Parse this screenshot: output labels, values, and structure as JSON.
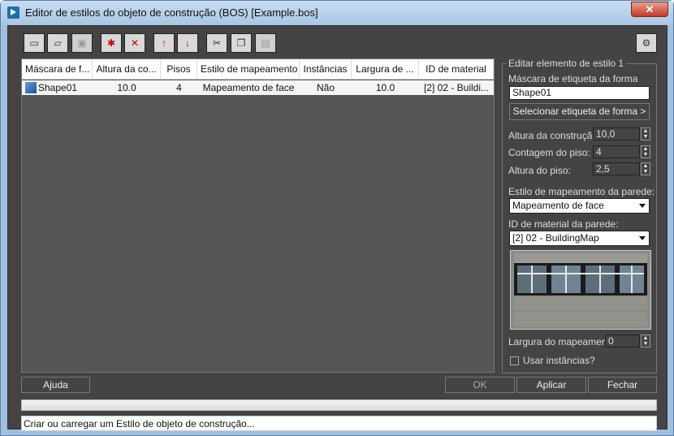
{
  "window": {
    "title": "Editor de estilos do objeto de construção (BOS) [Example.bos]",
    "close_glyph": "✕"
  },
  "toolbar": {
    "buttons": [
      {
        "name": "new-file-icon",
        "glyph": "▭",
        "disabled": false
      },
      {
        "name": "open-folder-icon",
        "glyph": "▱",
        "disabled": false
      },
      {
        "name": "save-icon",
        "glyph": "▣",
        "disabled": true
      },
      {
        "name": "new-style-icon",
        "glyph": "✱",
        "disabled": false
      },
      {
        "name": "delete-style-icon",
        "glyph": "✕",
        "disabled": false
      },
      {
        "name": "move-up-icon",
        "glyph": "↑",
        "disabled": false
      },
      {
        "name": "move-down-icon",
        "glyph": "↓",
        "disabled": false
      },
      {
        "name": "cut-icon",
        "glyph": "✂",
        "disabled": false
      },
      {
        "name": "copy-icon",
        "glyph": "❐",
        "disabled": false
      },
      {
        "name": "paste-icon",
        "glyph": "▤",
        "disabled": true
      }
    ],
    "settings_glyph": "⚙"
  },
  "list": {
    "columns": [
      "Máscara de f...",
      "Altura da co...",
      "Pisos",
      "Estilo de mapeamento",
      "Instâncias",
      "Largura de ...",
      "ID de material"
    ],
    "rows": [
      {
        "cells": [
          "Shape01",
          "10.0",
          "4",
          "Mapeamento de face",
          "Não",
          "10.0",
          "[2] 02 - Buildi..."
        ]
      }
    ]
  },
  "editor": {
    "group_title": "Editar elemento de estilo 1",
    "mask_label": "Máscara de etiqueta da forma",
    "mask_value": "Shape01",
    "select_shape_label": "Selecionar etiqueta de forma >",
    "build_height_label": "Altura da construção:",
    "build_height_value": "10,0",
    "floor_count_label": "Contagem do piso:",
    "floor_count_value": "4",
    "floor_height_label": "Altura do piso:",
    "floor_height_value": "2,5",
    "wall_mapping_label": "Estilo de mapeamento da parede:",
    "wall_mapping_value": "Mapeamento de face",
    "wall_material_label": "ID de material da parede:",
    "wall_material_value": "[2] 02 - BuildingMap",
    "mapping_width_label": "Largura do mapeamento:",
    "mapping_width_value": "0",
    "use_instances_label": "Usar instâncias?"
  },
  "buttons": {
    "help": "Ajuda",
    "ok": "OK",
    "apply": "Aplicar",
    "close": "Fechar"
  },
  "status": {
    "text": "Criar ou carregar um Estilo de objeto de construção..."
  }
}
